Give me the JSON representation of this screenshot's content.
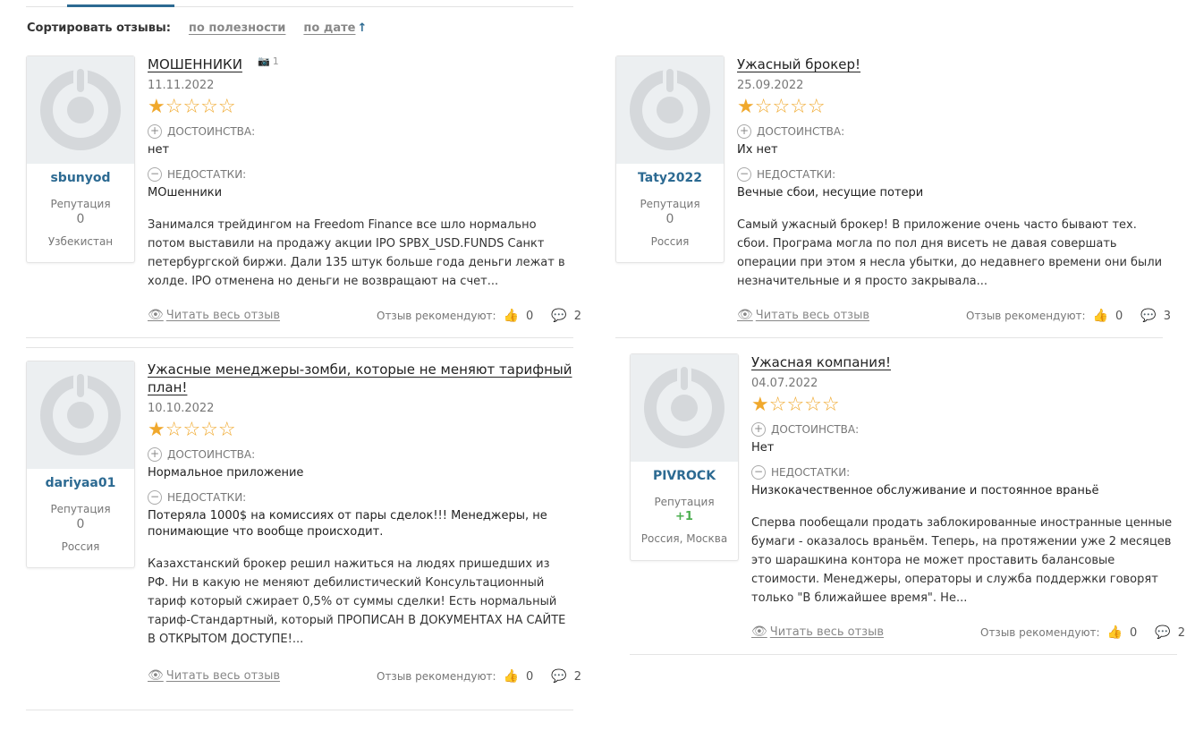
{
  "sort": {
    "label": "Сортировать отзывы:",
    "by_usefulness": "по полезности",
    "by_date": "по дате",
    "date_arrow": "↑"
  },
  "common": {
    "pros_label": "ДОСТОИНСТВА:",
    "cons_label": "НЕДОСТАТКИ:",
    "reputation_label": "Репутация",
    "read_more": "Читать весь отзыв",
    "recommend_label": "Отзыв рекомендуют:"
  },
  "reviews": [
    {
      "title": "МОШЕННИКИ",
      "photo_count": "1",
      "date": "11.11.2022",
      "rating": 1,
      "username": "sbunyod",
      "reputation": "0",
      "location": "Узбекистан",
      "pros": "нет",
      "cons": "МОшенники",
      "text": "Занимался трейдингом на Freedom Finance все шло нормально потом выставили на продажу акции IPO SPBX_USD.FUNDS Санкт петербургской биржи. Дали 135 штук больше года деньги лежат в холде. IPO отменена но деньги не возвращают на счет...",
      "likes": "0",
      "comments": "2"
    },
    {
      "title": "Ужасный брокер!",
      "date": "25.09.2022",
      "rating": 1,
      "username": "Taty2022",
      "reputation": "0",
      "location": "Россия",
      "pros": "Их нет",
      "cons": "Вечные сбои, несущие потери",
      "text": "Самый ужасный брокер! В приложение очень часто бывают тех. сбои. Програма могла по пол дня висеть не давая совершать операции при этом я несла убытки, до недавнего времени они были незначительные и я просто закрывала...",
      "likes": "0",
      "comments": "3"
    },
    {
      "title": "Ужасные менеджеры-зомби, которые не меняют тарифный план!",
      "date": "10.10.2022",
      "rating": 1,
      "username": "dariyaa01",
      "reputation": "0",
      "location": "Россия",
      "pros": "Нормальное приложение",
      "cons": "Потеряла 1000$ на комиссиях от пары сделок!!! Менеджеры, не понимающие что вообще происходит.",
      "text": "Казахстанский брокер решил нажиться на людях пришедших из РФ. Ни в какую не меняют дебилистический Консультационный тариф который сжирает 0,5% от суммы сделки! Есть нормальный тариф-Стандартный, который ПРОПИСАН В ДОКУМЕНТАХ НА САЙТЕ В ОТКРЫТОМ ДОСТУПЕ!...",
      "likes": "0",
      "comments": "2"
    },
    {
      "title": "Ужасная компания!",
      "date": "04.07.2022",
      "rating": 1,
      "username": "PIVROCK",
      "reputation": "+1",
      "location": "Россия, Москва",
      "pros": "Нет",
      "cons": "Низкокачественное обслуживание и постоянное враньё",
      "text": "Сперва пообещали продать заблокированные иностранные ценные бумаги - оказалось враньём. Теперь, на протяжении уже 2 месяцев это шарашкина контора не может проставить балансовые стоимости. Менеджеры, операторы и служба поддержки говорят только \"В ближайшее время\". Не...",
      "likes": "0",
      "comments": "2"
    }
  ]
}
